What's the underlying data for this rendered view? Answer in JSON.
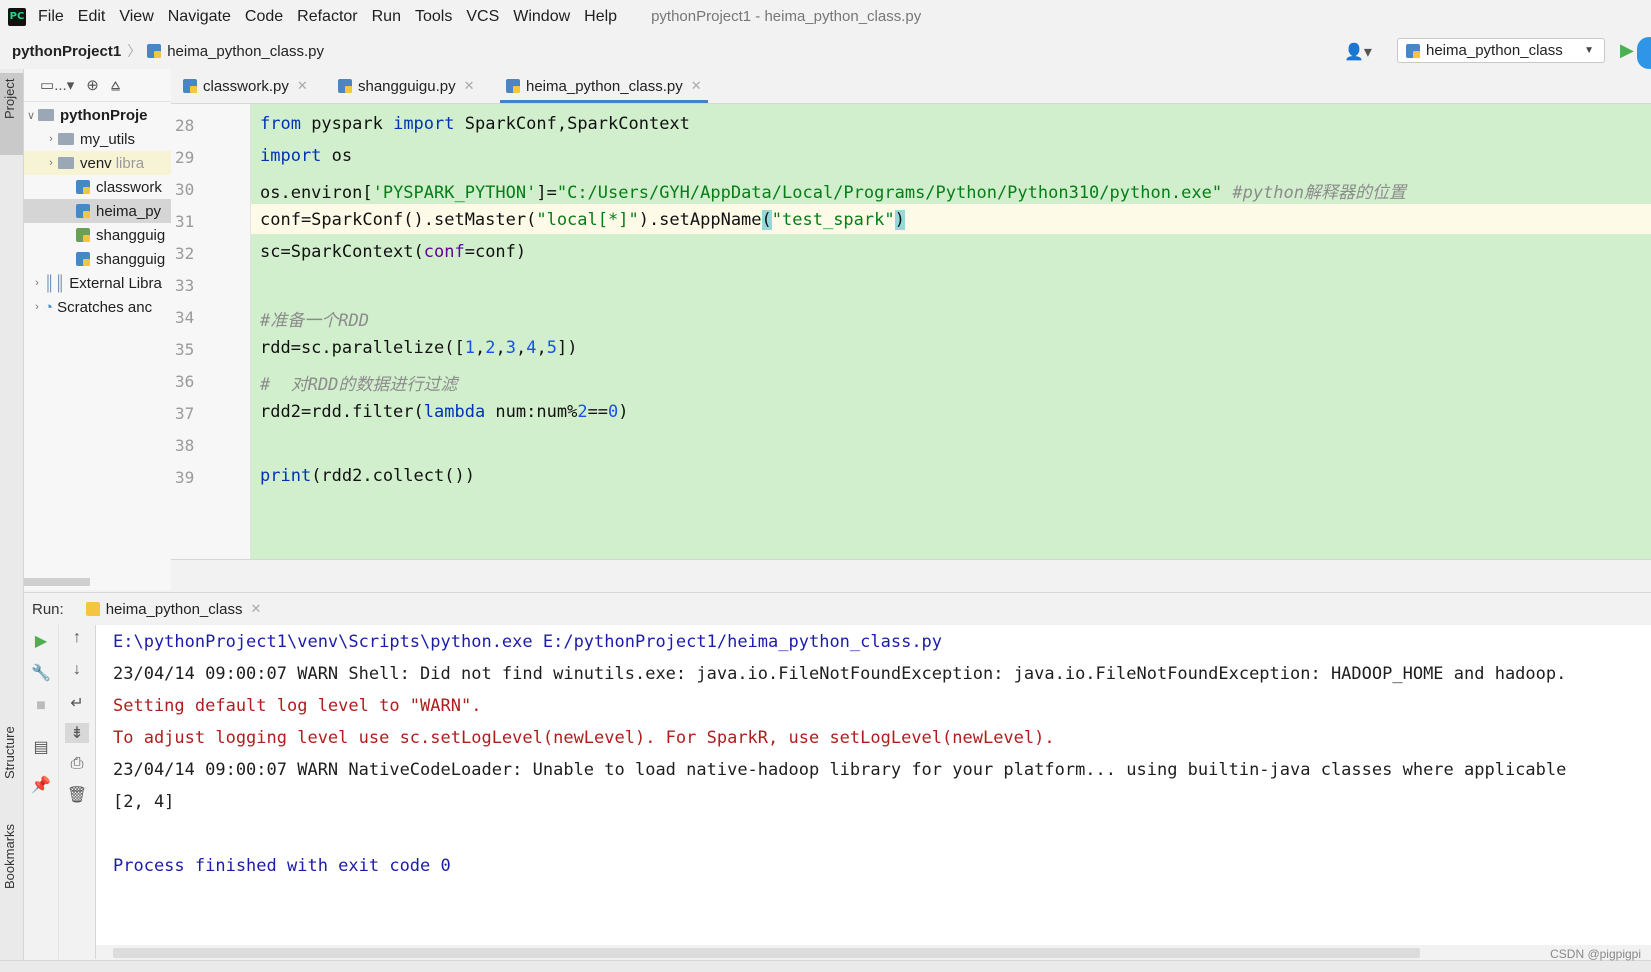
{
  "menu": {
    "items": [
      "File",
      "Edit",
      "View",
      "Navigate",
      "Code",
      "Refactor",
      "Run",
      "Tools",
      "VCS",
      "Window",
      "Help"
    ],
    "window_title": "pythonProject1 - heima_python_class.py"
  },
  "navbar": {
    "project": "pythonProject1",
    "file": "heima_python_class.py",
    "run_config": "heima_python_class"
  },
  "side_tabs": {
    "project": "Project",
    "structure": "Structure",
    "bookmarks": "Bookmarks"
  },
  "project_tree": {
    "toolbar_more": "...",
    "items": [
      {
        "label": "pythonProje",
        "extra": ""
      },
      {
        "label": "my_utils",
        "extra": ""
      },
      {
        "label": "venv",
        "extra": "libra"
      },
      {
        "label": "classwork",
        "extra": ""
      },
      {
        "label": "heima_py",
        "extra": ""
      },
      {
        "label": "shangguig",
        "extra": ""
      },
      {
        "label": "shangguig",
        "extra": ""
      },
      {
        "label": "External Libra",
        "extra": ""
      },
      {
        "label": "Scratches anc",
        "extra": ""
      }
    ]
  },
  "editor_tabs": [
    "classwork.py",
    "shangguigu.py",
    "heima_python_class.py"
  ],
  "code": {
    "line_numbers": [
      "28",
      "29",
      "30",
      "31",
      "32",
      "33",
      "34",
      "35",
      "36",
      "37",
      "38",
      "39"
    ],
    "l28": {
      "kw1": "from",
      "t1": " pyspark ",
      "kw2": "import",
      "t2": " SparkConf,SparkContext"
    },
    "l29": {
      "kw1": "import",
      "t1": " os"
    },
    "l30": {
      "t1": "os.environ[",
      "s1": "'PYSPARK_PYTHON'",
      "t2": "]=",
      "s2": "\"C:/Users/GYH/AppData/Local/Programs/Python/Python310/python.exe\"",
      "c1": " #python解释器的位置"
    },
    "l31": {
      "t1": "conf=SparkConf().setMaster(",
      "s1": "\"local[*]\"",
      "t2": ").setAppName",
      "b1": "(",
      "s2": "\"test_spark\"",
      "b2": ")"
    },
    "l32": {
      "t1": "sc=SparkContext(",
      "p1": "conf",
      "t2": "=conf)"
    },
    "l34": {
      "c1": "#准备一个RDD"
    },
    "l35": {
      "t1": "rdd=sc.parallelize([",
      "n1": "1",
      "t2": ",",
      "n2": "2",
      "t3": ",",
      "n3": "3",
      "t4": ",",
      "n4": "4",
      "t5": ",",
      "n5": "5",
      "t6": "])"
    },
    "l36": {
      "c1": "#  对RDD的数据进行过滤"
    },
    "l37": {
      "t1": "rdd2=rdd.filter(",
      "kw1": "lambda",
      "t2": " num:num%",
      "n1": "2",
      "t3": "==",
      "n2": "0",
      "t4": ")"
    },
    "l39": {
      "kw1": "print",
      "t1": "(rdd2.collect())"
    }
  },
  "run": {
    "label": "Run:",
    "tab": "heima_python_class",
    "output": [
      "E:\\pythonProject1\\venv\\Scripts\\python.exe E:/pythonProject1/heima_python_class.py",
      "23/04/14 09:00:07 WARN Shell: Did not find winutils.exe: java.io.FileNotFoundException: java.io.FileNotFoundException: HADOOP_HOME and hadoop.",
      "Setting default log level to \"WARN\".",
      "To adjust logging level use sc.setLogLevel(newLevel). For SparkR, use setLogLevel(newLevel).",
      "23/04/14 09:00:07 WARN NativeCodeLoader: Unable to load native-hadoop library for your platform... using builtin-java classes where applicable",
      "[2, 4]",
      "Process finished with exit code 0"
    ]
  },
  "watermark": "CSDN @pigpigpi"
}
